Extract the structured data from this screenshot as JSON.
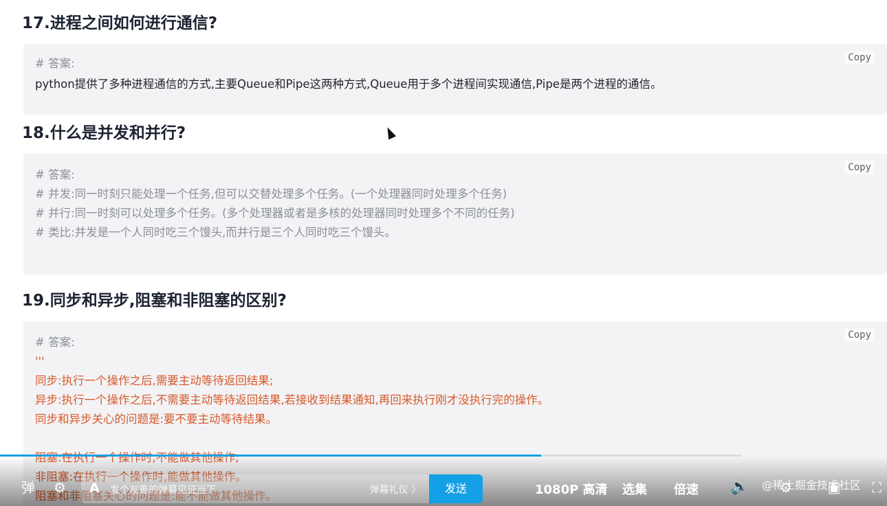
{
  "q17": {
    "title": "17.进程之间如何进行通信?",
    "copy": "Copy",
    "lines": [
      {
        "style": "comment",
        "text": "# 答案:"
      },
      {
        "style": "plain",
        "text": "python提供了多种进程通信的方式,主要Queue和Pipe这两种方式,Queue用于多个进程间实现通信,Pipe是两个进程的通信。"
      }
    ]
  },
  "q18": {
    "title": "18.什么是并发和并行?",
    "copy": "Copy",
    "lines": [
      {
        "style": "comment",
        "text": "# 答案:"
      },
      {
        "style": "comment",
        "text": "# 并发:同一时刻只能处理一个任务,但可以交替处理多个任务。(一个处理器同时处理多个任务)"
      },
      {
        "style": "comment",
        "text": "# 并行:同一时刻可以处理多个任务。(多个处理器或者是多核的处理器同时处理多个不同的任务)"
      },
      {
        "style": "comment",
        "text": "# 类比:并发是一个人同时吃三个馒头,而并行是三个人同时吃三个馒头。"
      }
    ]
  },
  "q19": {
    "title": "19.同步和异步,阻塞和非阻塞的区别?",
    "copy": "Copy",
    "lines": [
      {
        "style": "comment",
        "text": "# 答案:"
      },
      {
        "style": "str",
        "text": "'''"
      },
      {
        "style": "str",
        "text": "同步:执行一个操作之后,需要主动等待返回结果;"
      },
      {
        "style": "str",
        "text": "异步:执行一个操作之后,不需要主动等待返回结果,若接收到结果通知,再回来执行刚才没执行完的操作。"
      },
      {
        "style": "str",
        "text": "同步和异步关心的问题是:要不要主动等待结果。"
      },
      {
        "style": "blank",
        "text": ""
      },
      {
        "style": "str",
        "text": "阻塞:在执行一个操作时,不能做其他操作;"
      },
      {
        "style": "str",
        "text": "非阻塞:在执行一个操作时,能做其他操作。"
      },
      {
        "style": "str",
        "text": "阻塞和非阻塞关心的问题是:能不能做其他操作。"
      }
    ]
  },
  "player": {
    "progress": 0.73,
    "danmaku_placeholder": "发个友善的弹幕见证当下",
    "danmaku_etiquette": "弹幕礼仪 〉",
    "send_label": "发送",
    "quality_label": "1080P 高清",
    "episodes_label": "选集",
    "speed_label": "倍速",
    "watermark": "@稀土掘金技术社区",
    "accent_color": "#14a0e6"
  }
}
